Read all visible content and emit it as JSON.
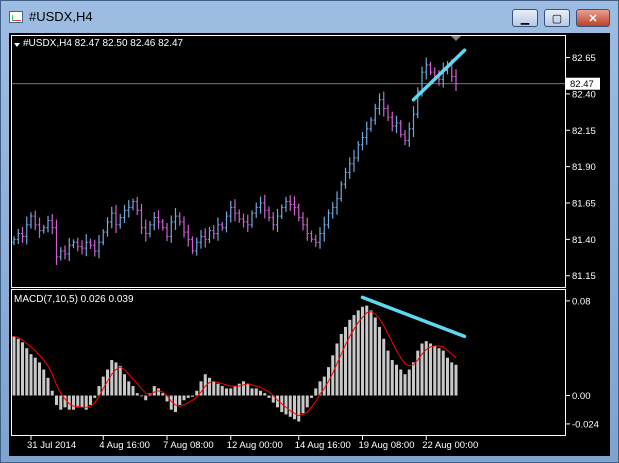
{
  "window": {
    "title": "#USDX,H4",
    "min_icon": "minimize-icon",
    "max_icon": "maximize-icon",
    "close_icon": "close-icon",
    "min_glyph": "▁",
    "max_glyph": "▢",
    "close_glyph": "✕"
  },
  "colors": {
    "background": "#000000",
    "frame": "#ffffff",
    "bull_candle": "#6fa8dc",
    "bear_candle": "#d060d0",
    "histogram": "#c8c8c8",
    "signal_line": "#ff0000",
    "trendline": "#5ed8f0"
  },
  "chart_data": [
    {
      "type": "ohlc",
      "header": "#USDX,H4  82.47 82.50 82.46 82.47",
      "ylim": [
        81.1,
        82.75
      ],
      "y_ticks": [
        "82.65",
        "82.40",
        "82.15",
        "81.90",
        "81.65",
        "81.40",
        "81.15"
      ],
      "current_price": "82.47",
      "closes": [
        81.4,
        81.44,
        81.42,
        81.5,
        81.56,
        81.5,
        81.46,
        81.48,
        81.53,
        81.48,
        81.28,
        81.32,
        81.3,
        81.36,
        81.38,
        81.35,
        81.34,
        81.38,
        81.36,
        81.32,
        81.38,
        81.45,
        81.52,
        81.58,
        81.5,
        81.55,
        81.6,
        81.62,
        81.66,
        81.6,
        81.48,
        81.44,
        81.5,
        81.55,
        81.52,
        81.48,
        81.42,
        81.52,
        81.56,
        81.52,
        81.45,
        81.4,
        81.32,
        81.38,
        81.42,
        81.4,
        81.46,
        81.44,
        81.5,
        81.48,
        81.56,
        81.62,
        81.58,
        81.54,
        81.52,
        81.5,
        81.58,
        81.62,
        81.65,
        81.6,
        81.55,
        81.5,
        81.56,
        81.62,
        81.66,
        81.64,
        81.62,
        81.55,
        81.5,
        81.44,
        81.4,
        81.38,
        81.44,
        81.5,
        81.58,
        81.62,
        81.68,
        81.78,
        81.86,
        81.92,
        81.96,
        82.05,
        82.1,
        82.16,
        82.22,
        82.3,
        82.36,
        82.3,
        82.24,
        82.18,
        82.2,
        82.12,
        82.08,
        82.16,
        82.26,
        82.42,
        82.55,
        82.6,
        82.55,
        82.52,
        82.5,
        82.56,
        82.6,
        82.52,
        82.47
      ],
      "trendline": [
        [
          94,
          82.36
        ],
        [
          106,
          82.7
        ]
      ],
      "x_ticks": [
        {
          "label": "31 Jul 2014",
          "index": 4
        },
        {
          "label": "4 Aug 16:00",
          "index": 21
        },
        {
          "label": "7 Aug 08:00",
          "index": 36
        },
        {
          "label": "12 Aug 00:00",
          "index": 51
        },
        {
          "label": "14 Aug 16:00",
          "index": 67
        },
        {
          "label": "19 Aug 08:00",
          "index": 82
        },
        {
          "label": "22 Aug 00:00",
          "index": 97
        }
      ]
    },
    {
      "type": "histogram+line",
      "header": "MACD(7,10,5) 0.026 0.039",
      "ylim": [
        -0.03,
        0.085
      ],
      "y_ticks": [
        "0.08",
        "0.00",
        "-0.024"
      ],
      "values": [
        0.05,
        0.048,
        0.045,
        0.04,
        0.035,
        0.032,
        0.028,
        0.022,
        0.015,
        0.004,
        -0.008,
        -0.012,
        -0.01,
        -0.012,
        -0.012,
        -0.01,
        -0.01,
        -0.012,
        -0.008,
        -0.002,
        0.008,
        0.016,
        0.022,
        0.03,
        0.028,
        0.025,
        0.018,
        0.012,
        0.008,
        0.002,
        0.0,
        -0.004,
        0.002,
        0.008,
        0.006,
        0.002,
        -0.005,
        -0.012,
        -0.014,
        -0.008,
        -0.004,
        -0.002,
        -0.001,
        0.004,
        0.012,
        0.018,
        0.015,
        0.012,
        0.01,
        0.008,
        0.006,
        0.006,
        0.008,
        0.01,
        0.012,
        0.01,
        0.006,
        0.006,
        0.004,
        0.002,
        -0.002,
        -0.006,
        -0.01,
        -0.014,
        -0.016,
        -0.018,
        -0.02,
        -0.022,
        -0.015,
        -0.01,
        -0.002,
        0.006,
        0.012,
        0.016,
        0.024,
        0.034,
        0.044,
        0.052,
        0.058,
        0.064,
        0.068,
        0.072,
        0.075,
        0.076,
        0.072,
        0.066,
        0.058,
        0.048,
        0.038,
        0.03,
        0.026,
        0.022,
        0.018,
        0.022,
        0.028,
        0.038,
        0.044,
        0.046,
        0.044,
        0.042,
        0.04,
        0.038,
        0.032,
        0.028,
        0.026
      ],
      "signal": [
        0.05,
        0.049,
        0.047,
        0.044,
        0.041,
        0.038,
        0.034,
        0.03,
        0.025,
        0.018,
        0.009,
        0.002,
        -0.003,
        -0.007,
        -0.009,
        -0.009,
        -0.01,
        -0.01,
        -0.009,
        -0.006,
        -0.001,
        0.006,
        0.012,
        0.018,
        0.022,
        0.024,
        0.022,
        0.018,
        0.014,
        0.01,
        0.006,
        0.002,
        0.001,
        0.003,
        0.004,
        0.003,
        0.0,
        -0.005,
        -0.008,
        -0.009,
        -0.008,
        -0.006,
        -0.004,
        -0.001,
        0.003,
        0.008,
        0.011,
        0.012,
        0.011,
        0.01,
        0.009,
        0.008,
        0.008,
        0.008,
        0.009,
        0.01,
        0.009,
        0.008,
        0.007,
        0.005,
        0.003,
        0.0,
        -0.004,
        -0.007,
        -0.01,
        -0.013,
        -0.015,
        -0.017,
        -0.016,
        -0.014,
        -0.01,
        -0.005,
        0.001,
        0.006,
        0.012,
        0.019,
        0.027,
        0.035,
        0.043,
        0.05,
        0.056,
        0.062,
        0.066,
        0.07,
        0.071,
        0.069,
        0.065,
        0.059,
        0.052,
        0.045,
        0.038,
        0.032,
        0.027,
        0.025,
        0.026,
        0.03,
        0.035,
        0.039,
        0.041,
        0.042,
        0.042,
        0.041,
        0.038,
        0.035,
        0.032
      ],
      "trendline": [
        [
          82,
          0.083
        ],
        [
          106,
          0.05
        ]
      ]
    }
  ]
}
